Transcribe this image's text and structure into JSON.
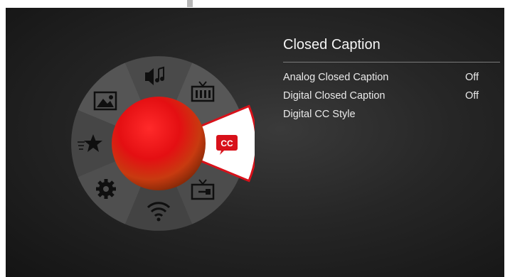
{
  "menu": {
    "title": "Closed Caption",
    "items": [
      {
        "label": "Analog Closed Caption",
        "value": "Off"
      },
      {
        "label": "Digital Closed Caption",
        "value": "Off"
      },
      {
        "label": "Digital CC Style",
        "value": ""
      }
    ]
  },
  "wheel": {
    "icons": [
      "picture-icon",
      "sound-icon",
      "channel-icon",
      "closed-caption-icon",
      "input-icon",
      "network-icon",
      "setup-icon",
      "favorites-icon"
    ],
    "selected_icon_label": "CC"
  },
  "colors": {
    "accent": "#d8111a",
    "selected_segment": "#ffffff",
    "background": "#222222",
    "text": "#eaeaea"
  }
}
